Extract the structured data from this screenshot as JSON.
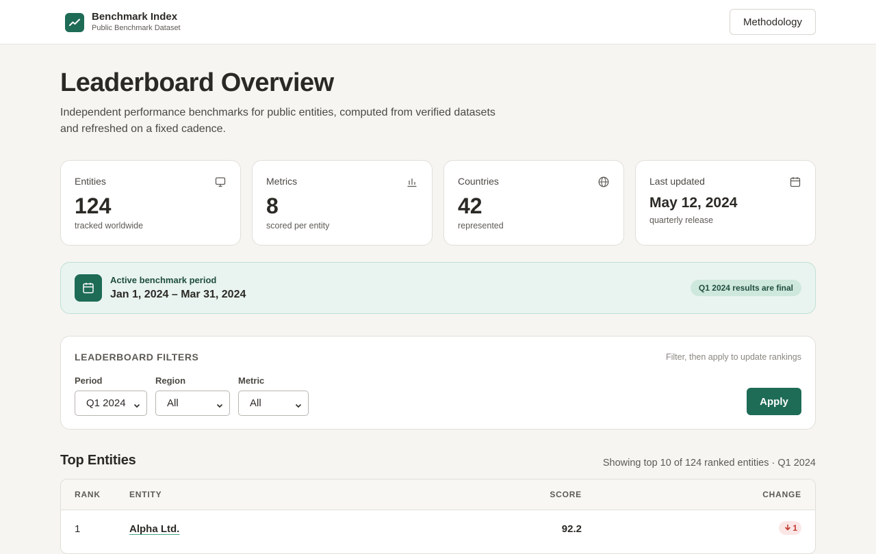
{
  "brand": {
    "title": "Benchmark Index",
    "subtitle": "Public Benchmark Dataset",
    "logo_icon": "trend-line-icon"
  },
  "header": {
    "methodology_label": "Methodology"
  },
  "hero": {
    "title": "Leaderboard Overview",
    "description": "Independent performance benchmarks for public entities, computed from verified datasets and refreshed on a fixed cadence."
  },
  "stats": [
    {
      "label": "Entities",
      "value": "124",
      "sub": "tracked worldwide",
      "icon": "monitor-icon"
    },
    {
      "label": "Metrics",
      "value": "8",
      "sub": "scored per entity",
      "icon": "bar-chart-icon"
    },
    {
      "label": "Countries",
      "value": "42",
      "sub": "represented",
      "icon": "globe-icon"
    },
    {
      "label": "Last updated",
      "value": "May 12, 2024",
      "sub": "quarterly release",
      "icon": "calendar-icon"
    }
  ],
  "period": {
    "label": "Active benchmark period",
    "dates": "Jan 1, 2024 – Mar 31, 2024",
    "badge": "Q1 2024 results are final",
    "icon": "calendar-icon"
  },
  "filters": {
    "title": "LEADERBOARD FILTERS",
    "hint": "Filter, then apply to update rankings",
    "period": {
      "label": "Period",
      "value": "Q1 2024"
    },
    "region": {
      "label": "Region",
      "value": "All"
    },
    "metric": {
      "label": "Metric",
      "value": "All"
    },
    "apply_label": "Apply"
  },
  "top_entities": {
    "title": "Top Entities",
    "meta": "Showing top 10 of 124 ranked entities · Q1 2024",
    "columns": {
      "rank": "RANK",
      "entity": "ENTITY",
      "score": "SCORE",
      "change": "CHANGE"
    },
    "rows": [
      {
        "rank": "1",
        "entity": "Alpha Ltd.",
        "score": "92.2",
        "change": "1",
        "change_direction": "down"
      }
    ]
  },
  "colors": {
    "accent": "#1e6b56",
    "background": "#f6f5f2",
    "negative": "#c0392b",
    "negative_bg": "#fbe6e6"
  }
}
